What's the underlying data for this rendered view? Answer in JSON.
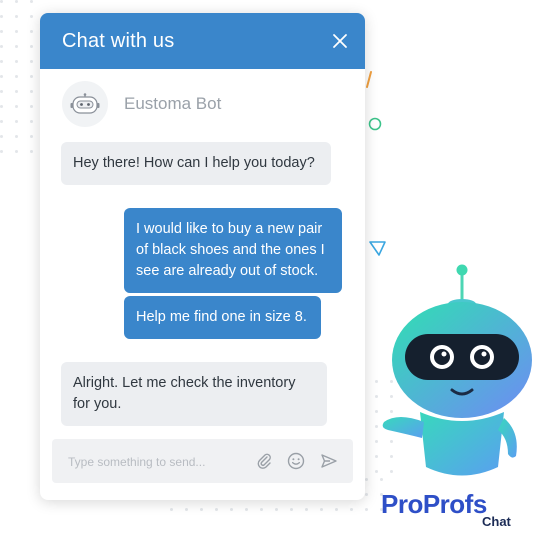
{
  "widget": {
    "header_title": "Chat with us",
    "bot_name": "Eustoma Bot",
    "icons": [
      "close-icon",
      "bot-face-icon",
      "paperclip-icon",
      "smiley-icon",
      "send-icon"
    ]
  },
  "messages": [
    {
      "sender": "bot",
      "text": "Hey there! How can I help you today?"
    },
    {
      "sender": "user",
      "text": "I would like to buy a new pair of black shoes and the ones I see are already out of stock."
    },
    {
      "sender": "user",
      "text": "Help me find one in size 8."
    },
    {
      "sender": "bot",
      "text": "Alright. Let me check the inventory for you."
    }
  ],
  "composer": {
    "value": "",
    "placeholder": "Type something to send..."
  },
  "brand": {
    "name": "ProProfs",
    "product": "Chat"
  },
  "colors": {
    "primary": "#3a86cb",
    "bot_bubble": "#eceef1",
    "brand_blue": "#2e4fc7",
    "robot_gradient_start": "#2ee0b0",
    "robot_gradient_end": "#6e8cf6"
  }
}
